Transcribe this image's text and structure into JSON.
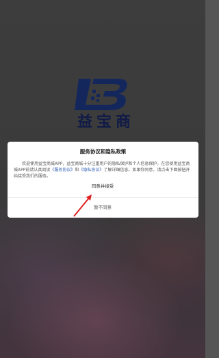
{
  "app": {
    "brand_title": "益宝商城"
  },
  "dialog": {
    "title": "服务协议和隐私政策",
    "body_part1": "欢迎使用益宝商城APP，益宝商城十分注重用户的隐私保护和个人信息保护，在您使用益宝商城APP前请认真阅读",
    "link_service": "《服务协议》",
    "and": "和",
    "link_privacy": "《隐私协议》",
    "body_part2": "了解详细信息。如果你同意，请点击下面按钮开始接受我们的服务。",
    "agree_label": "同意并接受",
    "decline_label": "暂不同意"
  },
  "colors": {
    "link": "#2d5db3",
    "brand": "#1a2a6e",
    "annotation_arrow": "#e02020"
  }
}
